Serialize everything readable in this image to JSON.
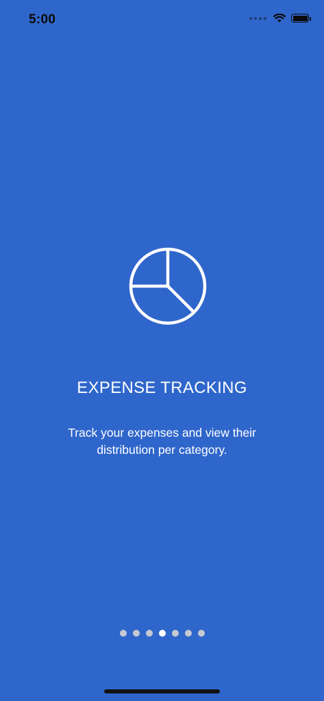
{
  "status_bar": {
    "time": "5:00",
    "icons": [
      "signal-dots-icon",
      "wifi-icon",
      "battery-icon"
    ]
  },
  "onboarding": {
    "icon": "pie-chart-icon",
    "title": "EXPENSE TRACKING",
    "description": "Track your expenses and view their distribution per category.",
    "page_count": 7,
    "current_page": 4
  },
  "colors": {
    "background": "#2f66cb",
    "text": "#ffffff",
    "dot_inactive": "#c5c9d1",
    "dot_active": "#ffffff"
  }
}
